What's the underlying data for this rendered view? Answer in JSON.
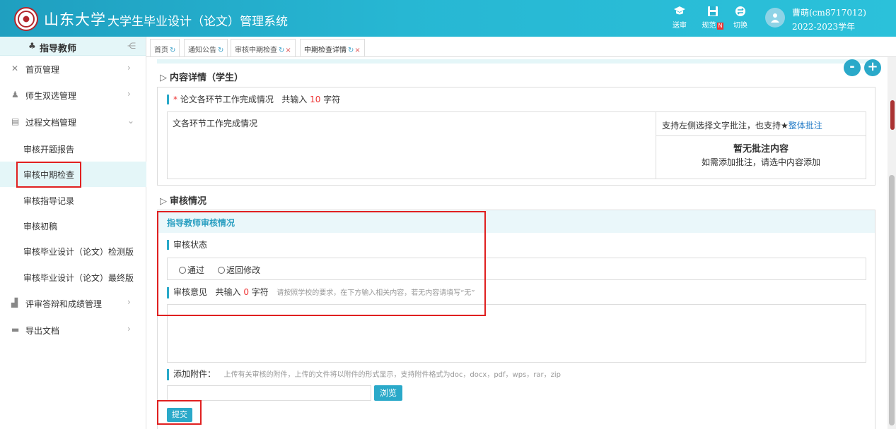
{
  "header": {
    "university": "山东大学",
    "system_title": "大学生毕业设计（论文）管理系统",
    "buttons": [
      {
        "label": "送审",
        "icon": "graduation-cap-icon"
      },
      {
        "label": "规范",
        "badge": "N",
        "icon": "save-icon"
      },
      {
        "label": "切换",
        "icon": "switch-icon"
      }
    ],
    "user": {
      "name": "曹萌(cm8717012)",
      "year": "2022-2023学年"
    }
  },
  "sidebar": {
    "role": "指导教师",
    "menus": [
      {
        "label": "首页管理",
        "icon": "tools-icon"
      },
      {
        "label": "师生双选管理",
        "icon": "users-icon"
      },
      {
        "label": "过程文档管理",
        "icon": "document-icon"
      },
      {
        "label": "评审答辩和成绩管理",
        "icon": "chart-icon"
      },
      {
        "label": "导出文档",
        "icon": "folder-icon"
      }
    ],
    "sub_items": [
      {
        "label": "审核开题报告"
      },
      {
        "label": "审核中期检查"
      },
      {
        "label": "审核指导记录"
      },
      {
        "label": "审核初稿"
      },
      {
        "label": "审核毕业设计（论文）检测版"
      },
      {
        "label": "审核毕业设计（论文）最终版"
      }
    ]
  },
  "tabs": [
    {
      "label": "首页",
      "closable": false
    },
    {
      "label": "通知公告",
      "closable": false
    },
    {
      "label": "审核中期检查",
      "closable": true
    },
    {
      "label": "中期检查详情",
      "closable": true
    }
  ],
  "content": {
    "section1_title": "内容详情（学生）",
    "field_label": "论文各环节工作完成情况",
    "count_prefix": "共输入",
    "count_value": "10",
    "count_suffix": "字符",
    "student_text": "文各环节工作完成情况",
    "annot_hint_prefix": "支持左侧选择文字批注，也支持★",
    "annot_hint_link": "整体批注",
    "no_annot_title": "暂无批注内容",
    "no_annot_desc": "如需添加批注，请选中内容添加",
    "section2_title": "审核情况",
    "review_header": "指导教师审核情况",
    "status_label": "审核状态",
    "radio_pass": "通过",
    "radio_return": "返回修改",
    "opinion_label": "审核意见",
    "opinion_count_prefix": "共输入",
    "opinion_count_value": "0",
    "opinion_count_suffix": "字符",
    "opinion_hint": "请按照学校的要求，在下方输入相关内容，若无内容请填写“无”",
    "attach_label": "添加附件：",
    "attach_hint": "上传有关审核的附件，上传的文件将以附件的形式显示，支持附件格式为doc，docx，pdf，wps，rar，zip",
    "browse_label": "浏览",
    "submit_label": "提交",
    "minus_label": "-",
    "plus_label": "+"
  }
}
